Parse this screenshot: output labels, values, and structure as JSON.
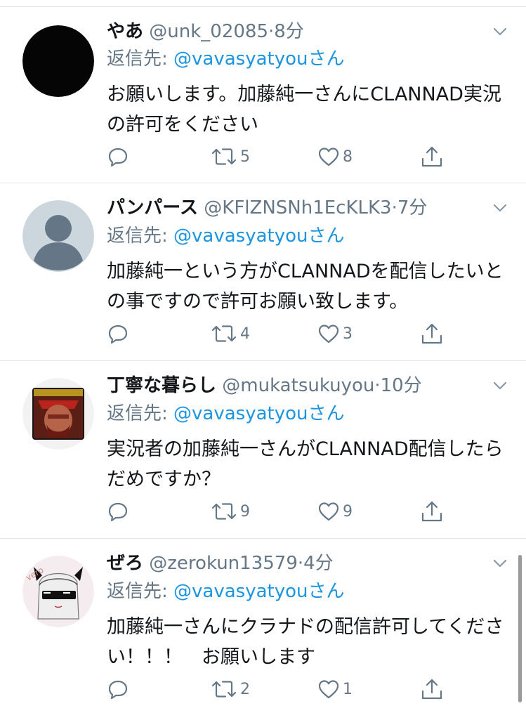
{
  "tweets": [
    {
      "name": "やあ",
      "handle": "@unk_02085",
      "time": "8分",
      "reply_prefix": "返信先: ",
      "reply_to": "@vavasyatyouさん",
      "text": "お願いします。加藤純一さんにCLANNAD実況の許可をください",
      "replies": "",
      "retweets": "5",
      "likes": "8",
      "avatar": "black-circle"
    },
    {
      "name": "パンパース",
      "handle": "@KFlZNSNh1EcKLK3",
      "time": "7分",
      "reply_prefix": "返信先: ",
      "reply_to": "@vavasyatyouさん",
      "text": "加藤純一という方がCLANNADを配信したいとの事ですので許可お願い致します。",
      "replies": "",
      "retweets": "4",
      "likes": "3",
      "avatar": "default-profile"
    },
    {
      "name": "丁寧な暮らし",
      "handle": "@mukatsukuyou",
      "time": "10分",
      "reply_prefix": "返信先: ",
      "reply_to": "@vavasyatyouさん",
      "text": "実況者の加藤純一さんがCLANNAD配信したらだめですか？",
      "replies": "",
      "retweets": "9",
      "likes": "9",
      "avatar": "game-character-portrait"
    },
    {
      "name": "ぜろ",
      "handle": "@zerokun13579",
      "time": "4分",
      "reply_prefix": "返信先: ",
      "reply_to": "@vavasyatyouさん",
      "text": "加藤純一さんにクラナドの配信許可してください！！！　お願いします",
      "replies": "",
      "retweets": "2",
      "likes": "1",
      "avatar": "anime-girl-sunglasses"
    }
  ],
  "separator": "·",
  "colors": {
    "link": "#1b95e0",
    "muted": "#657786",
    "text": "#14171a",
    "divider": "#e1e8ed"
  }
}
